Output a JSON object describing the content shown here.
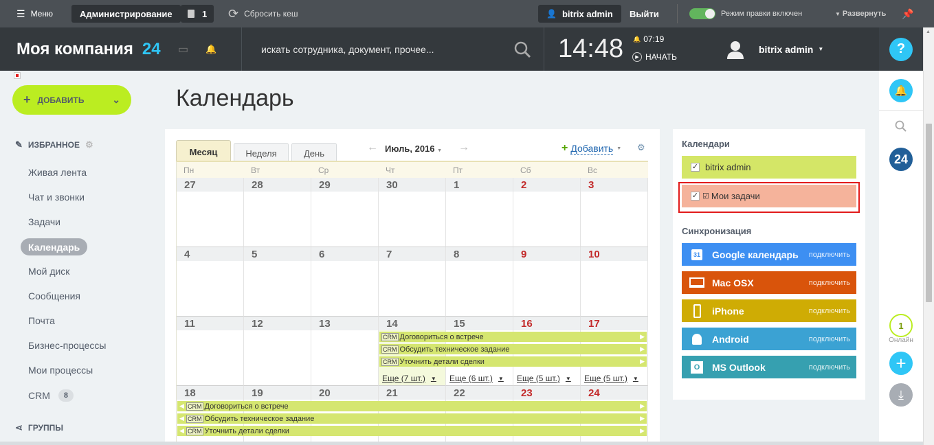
{
  "admin": {
    "menu_label": "Меню",
    "admin_label": "Администрирование",
    "notif_count": "1",
    "clear_cache": "Сбросить кеш",
    "user": "bitrix admin",
    "logout": "Выйти",
    "edit_mode": "Режим правки включен",
    "expand": "Развернуть"
  },
  "header": {
    "company": "Моя компания",
    "company_num": "24",
    "search_placeholder": "искать сотрудника, документ, прочее...",
    "time": "14:48",
    "alarm_time": "07:19",
    "start_label": "НАЧАТЬ",
    "user": "bitrix admin"
  },
  "leftmenu": {
    "add_label": "ДОБАВИТЬ",
    "favorites": "ИЗБРАННОЕ",
    "items": [
      {
        "label": "Живая лента"
      },
      {
        "label": "Чат и звонки"
      },
      {
        "label": "Задачи"
      },
      {
        "label": "Календарь"
      },
      {
        "label": "Мой диск"
      },
      {
        "label": "Сообщения"
      },
      {
        "label": "Почта"
      },
      {
        "label": "Бизнес-процессы"
      },
      {
        "label": "Мои процессы"
      },
      {
        "label": "CRM",
        "count": "8"
      }
    ],
    "groups": "ГРУППЫ"
  },
  "page_title": "Календарь",
  "calendar": {
    "tabs": [
      "Месяц",
      "Неделя",
      "День"
    ],
    "period": "Июль, 2016",
    "add_label": "Добавить",
    "weekdays": [
      "Пн",
      "Вт",
      "Ср",
      "Чт",
      "Пт",
      "Сб",
      "Вс"
    ],
    "weeks": [
      [
        "27",
        "28",
        "29",
        "30",
        "1",
        "2",
        "3"
      ],
      [
        "4",
        "5",
        "6",
        "7",
        "8",
        "9",
        "10"
      ],
      [
        "11",
        "12",
        "13",
        "14",
        "15",
        "16",
        "17"
      ],
      [
        "18",
        "19",
        "20",
        "21",
        "22",
        "23",
        "24"
      ]
    ],
    "event_tag": "CRM",
    "week3_events": [
      "Договориться о встрече",
      "Обсудить техническое задание",
      "Уточнить детали сделки"
    ],
    "week3_more": [
      "Еще (7 шт.)",
      "Еще (6 шт.)",
      "Еще (5 шт.)",
      "Еще (5 шт.)"
    ],
    "week4_events": [
      "Договориться о встрече",
      "Обсудить техническое задание",
      "Уточнить детали сделки"
    ]
  },
  "sidepanel": {
    "calendars_title": "Календари",
    "calendars": [
      {
        "label": "bitrix admin",
        "color": "#d4e667"
      },
      {
        "label": "Мои задачи",
        "color": "#f5b39b"
      }
    ],
    "sync_title": "Синхронизация",
    "sync": [
      {
        "label": "Google календарь",
        "action": "подключить",
        "color": "#3d8ff2",
        "icon": "google-calendar-icon"
      },
      {
        "label": "Mac OSX",
        "action": "подключить",
        "color": "#d9540b",
        "icon": "monitor-icon"
      },
      {
        "label": "iPhone",
        "action": "подключить",
        "color": "#cfac04",
        "icon": "phone-icon"
      },
      {
        "label": "Android",
        "action": "подключить",
        "color": "#3ba2d3",
        "icon": "android-icon"
      },
      {
        "label": "MS Outlook",
        "action": "подключить",
        "color": "#36a0b0",
        "icon": "outlook-icon"
      }
    ]
  },
  "rightpanel": {
    "counter_24": "24",
    "online_count": "1",
    "online_label": "Онлайн"
  },
  "colors": {
    "accent_green": "#bbed21",
    "weekend_red": "#c32a2a",
    "event_green": "#d5e670",
    "highlight_red": "#e21b1b"
  }
}
